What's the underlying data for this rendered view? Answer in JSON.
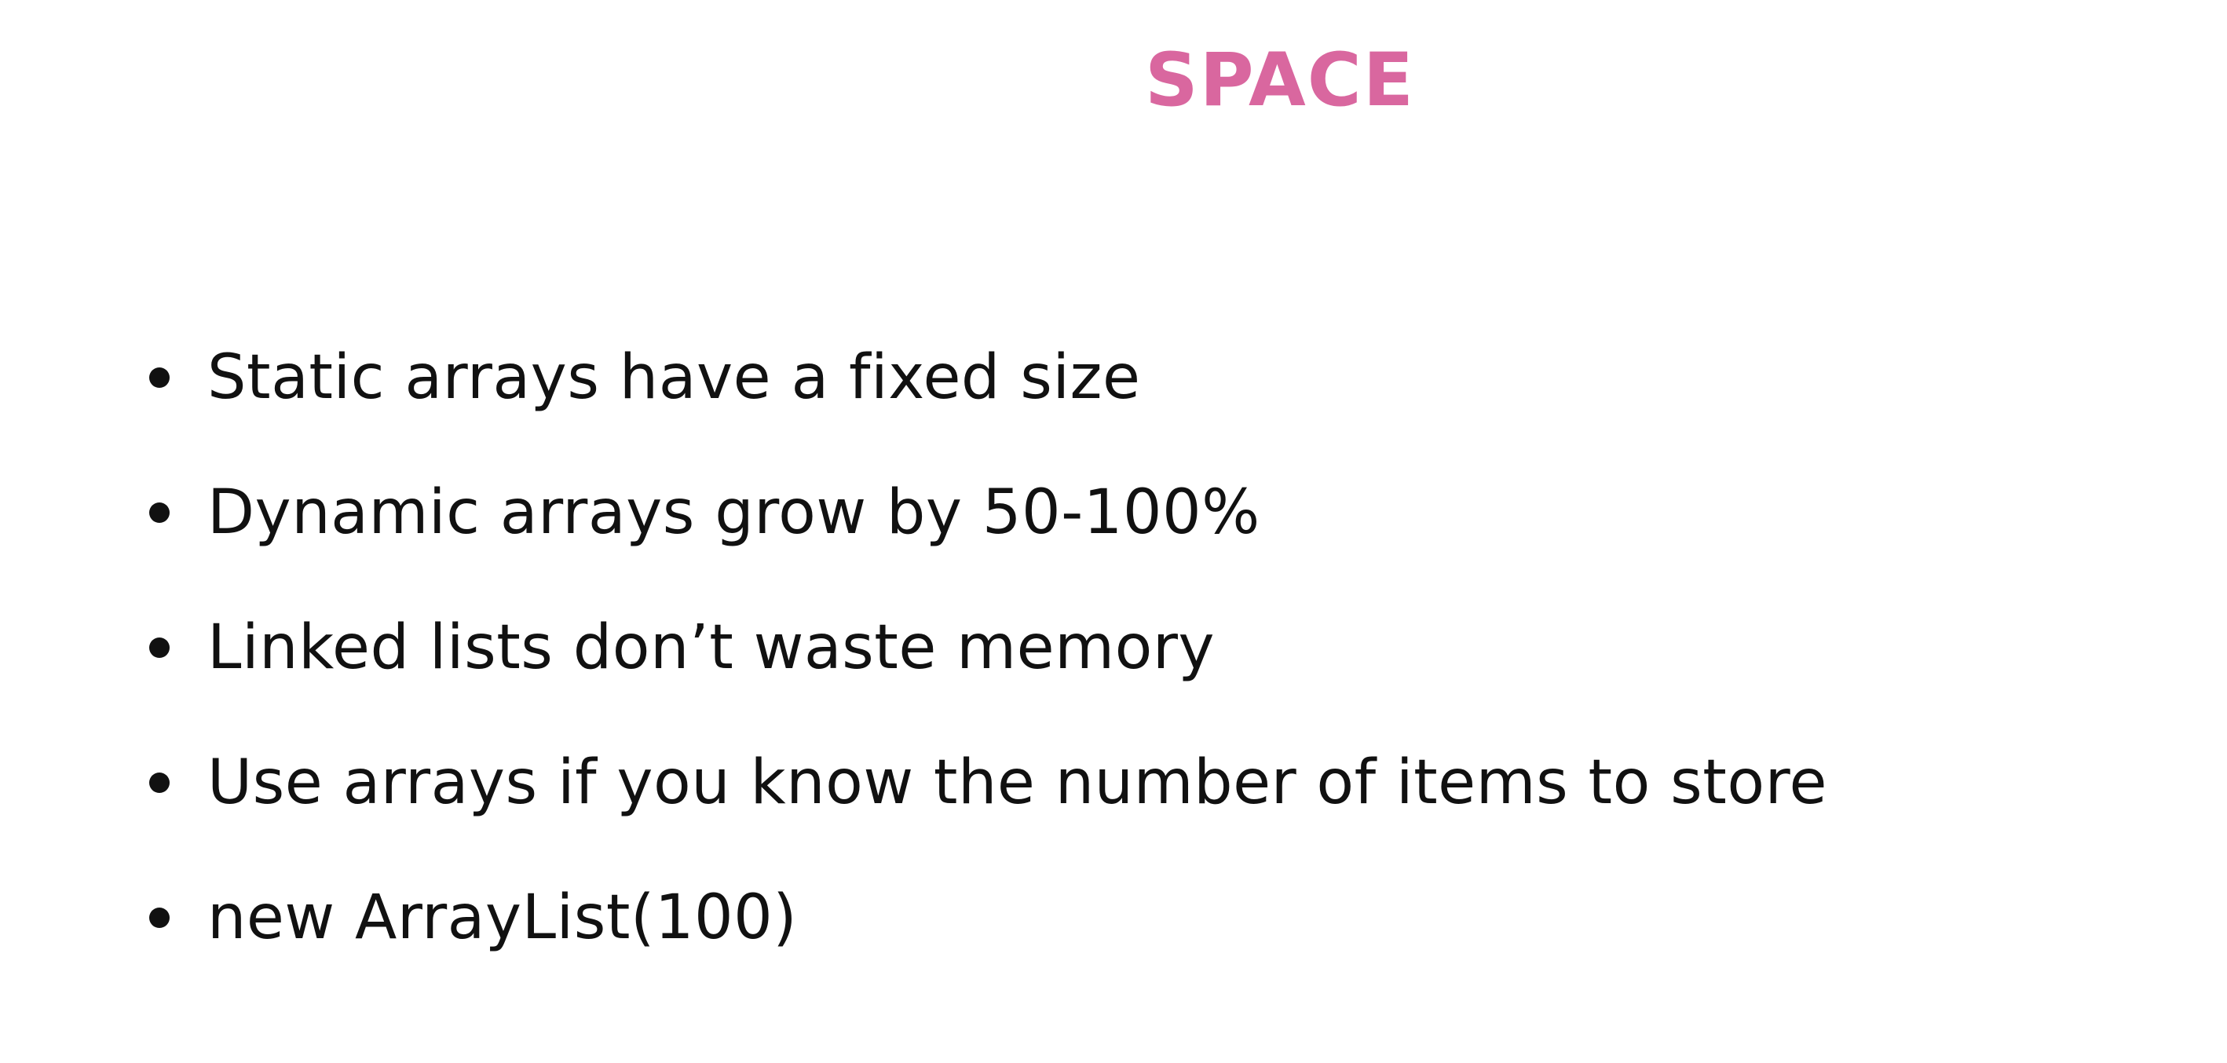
{
  "slide": {
    "title": "SPACE",
    "title_color": "#d9679f",
    "bullets": [
      "Static arrays have a fixed size",
      "Dynamic arrays grow by 50-100%",
      "Linked lists don’t waste memory",
      "Use arrays if you know the number of items to store",
      "new ArrayList(100)"
    ]
  }
}
